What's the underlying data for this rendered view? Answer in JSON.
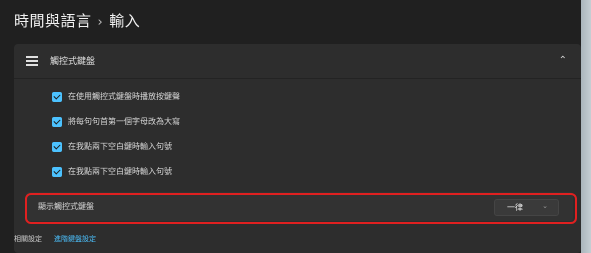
{
  "breadcrumb": {
    "parent": "時間與語言",
    "separator": "›",
    "current": "輸入"
  },
  "section": {
    "title": "觸控式鍵盤",
    "expanded": true
  },
  "checkboxes": [
    {
      "label": "在使用觸控式鍵盤時播放按鍵聲",
      "checked": true
    },
    {
      "label": "將每句句首第一個字母改為大寫",
      "checked": true
    },
    {
      "label": "在我點兩下空白鍵時輸入句號",
      "checked": true
    },
    {
      "label": "在我點兩下空白鍵時輸入句號",
      "checked": true
    }
  ],
  "setting": {
    "label": "顯示觸控式鍵盤",
    "selected": "一律"
  },
  "footer": {
    "label": "相關設定",
    "link": "進階鍵盤設定"
  },
  "colors": {
    "accent": "#4cc2ff",
    "highlight": "#e02020"
  },
  "icons": {
    "menu": "hamburger-icon",
    "collapse": "chevron-up-icon",
    "dropdown": "chevron-down-icon"
  }
}
